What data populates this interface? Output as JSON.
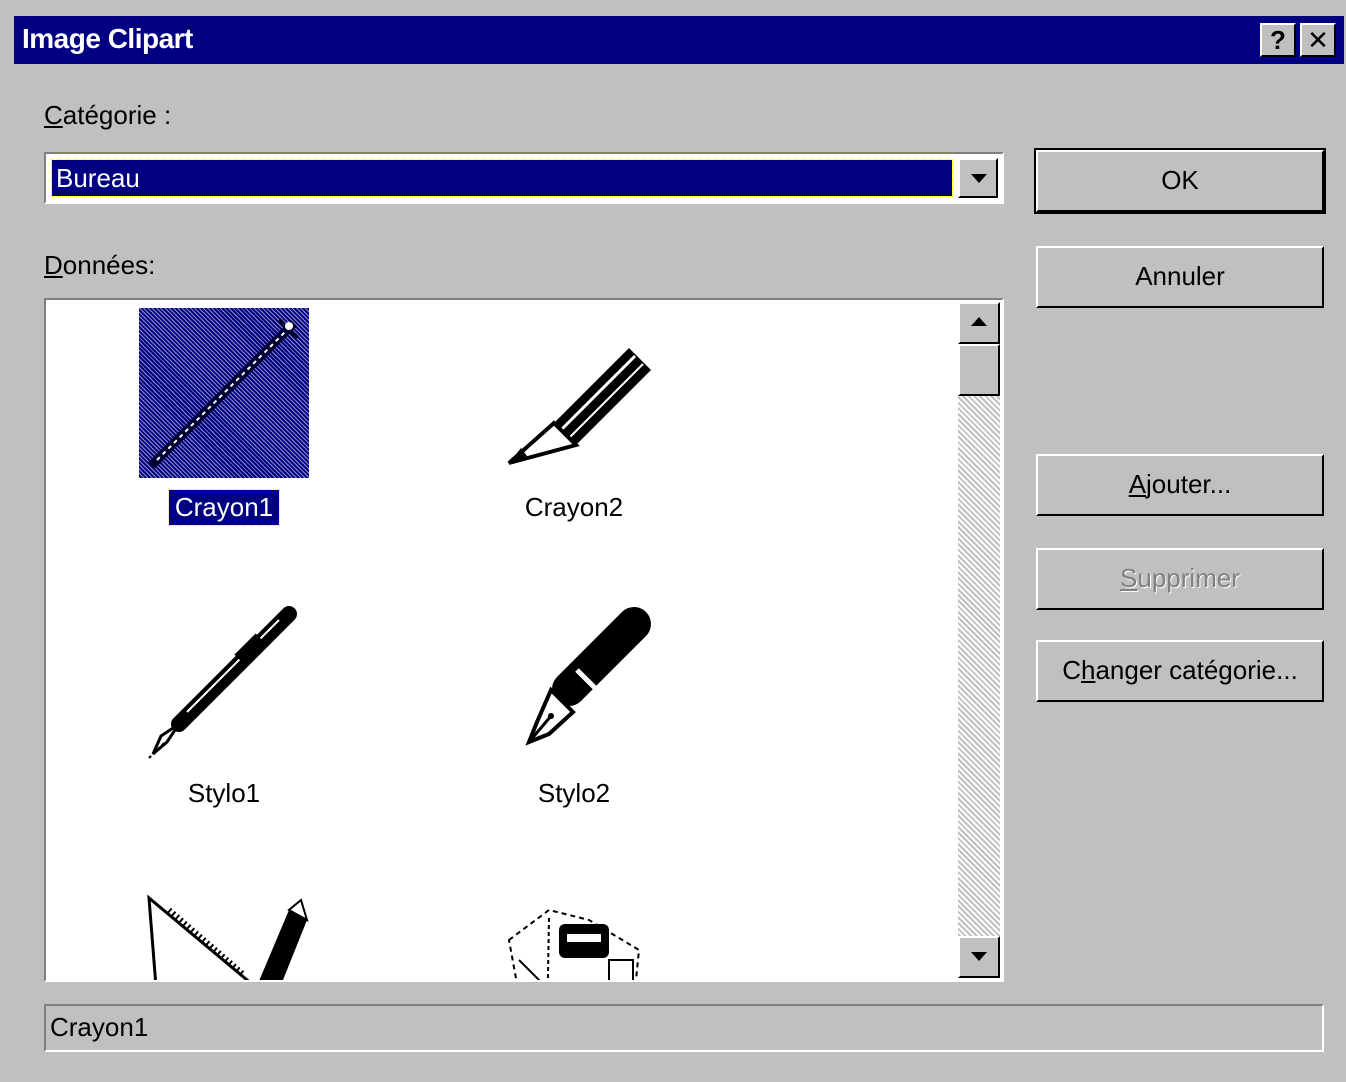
{
  "window": {
    "title": "Image Clipart",
    "help_label": "?",
    "close_label": "✕"
  },
  "category": {
    "label_mnemonic": "C",
    "label_rest": "atégorie :",
    "value": "Bureau"
  },
  "data_section": {
    "label_mnemonic": "D",
    "label_rest": "onnées:"
  },
  "items": [
    {
      "name": "Crayon1",
      "icon": "pencil-thin-icon",
      "selected": true
    },
    {
      "name": "Crayon2",
      "icon": "pencil-icon",
      "selected": false
    },
    {
      "name": "Stylo1",
      "icon": "ballpoint-pen-icon",
      "selected": false
    },
    {
      "name": "Stylo2",
      "icon": "fountain-pen-icon",
      "selected": false
    },
    {
      "name": "",
      "icon": "ruler-pencil-icon",
      "selected": false
    },
    {
      "name": "",
      "icon": "desk-items-icon",
      "selected": false
    }
  ],
  "buttons": {
    "ok": "OK",
    "cancel": "Annuler",
    "add_mnemonic": "A",
    "add_rest": "jouter...",
    "delete_mnemonic": "S",
    "delete_rest": "upprimer",
    "change_pre": "C",
    "change_mnemonic": "h",
    "change_rest": "anger catégorie..."
  },
  "status": {
    "selected_name": "Crayon1"
  },
  "colors": {
    "title_bar": "#000080",
    "face": "#c0c0c0",
    "selection": "#000080"
  }
}
